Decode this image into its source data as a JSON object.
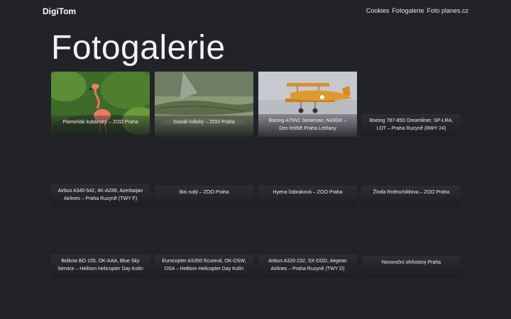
{
  "header": {
    "brand": "DigiTom",
    "nav": [
      "Cookies",
      "Fotogalerie",
      "Foto planes.cz"
    ]
  },
  "page": {
    "title": "Fotogalerie"
  },
  "gallery": [
    {
      "caption": "Plameňák kubánský – ZOO Praha",
      "image": "flamingo"
    },
    {
      "caption": "Gaviál indický – ZOO Praha",
      "image": "gharial"
    },
    {
      "caption": "Boeing A75N1 Stearman, N43GK – Den letiště Praha Letňany",
      "image": "biplane"
    },
    {
      "caption": "Boeing 787-85D Dreamliner, SP-LRA, LOT – Praha Ruzyně (RWY 24)",
      "image": ""
    },
    {
      "caption": "Airbus A340-542, 4K-AZ86, Azerbaijan Airlines – Praha Ruzyně (TWY F)",
      "image": ""
    },
    {
      "caption": "Ibis rudý – ZOO Praha",
      "image": ""
    },
    {
      "caption": "Hyena čabraková – ZOO Praha",
      "image": ""
    },
    {
      "caption": "Žirafa Rothschildova – ZOO Praha",
      "image": ""
    },
    {
      "caption": "Bolkow BO 105, OK-AAA, Blue Sky Service – Helitom Helicopter Day Kolín",
      "image": ""
    },
    {
      "caption": "Eurocopter AS350 Ecureuil, OK-DSW, DSA – Helitom Helicopter Day Kolín",
      "image": ""
    },
    {
      "caption": "Airbus A320-232, SX-DGD, Aegean Airlines – Praha Ruzyně (TWY D)",
      "image": ""
    },
    {
      "caption": "Novoroční ohňostroj Praha",
      "image": ""
    }
  ]
}
